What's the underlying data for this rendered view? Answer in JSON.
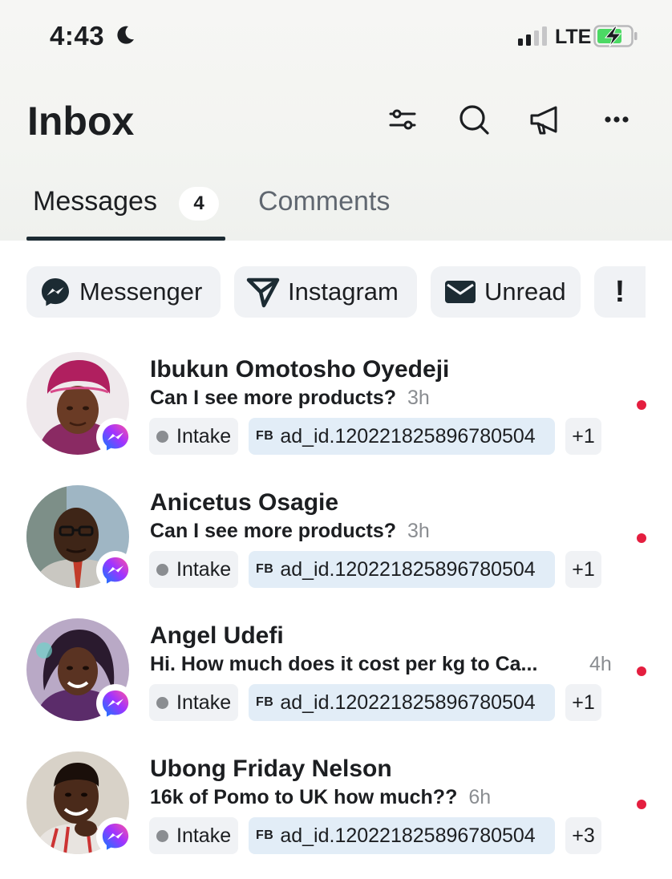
{
  "status_bar": {
    "time": "4:43",
    "network": "LTE",
    "moon_icon": "moon-icon",
    "signal_icon": "signal-bars-icon",
    "battery_icon": "battery-charging-icon"
  },
  "header": {
    "title": "Inbox",
    "icons": [
      "filter-sliders-icon",
      "search-icon",
      "megaphone-icon",
      "more-dots-icon"
    ]
  },
  "tabs": [
    {
      "label": "Messages",
      "badge": "4",
      "active": true
    },
    {
      "label": "Comments",
      "active": false
    }
  ],
  "filters": [
    {
      "label": "Messenger",
      "icon": "messenger-icon"
    },
    {
      "label": "Instagram",
      "icon": "instagram-direct-icon"
    },
    {
      "label": "Unread",
      "icon": "envelope-icon"
    },
    {
      "label": "!",
      "icon": ""
    }
  ],
  "conversations": [
    {
      "name": "Ibukun Omotosho Oyedeji",
      "preview": "Can I see more products?",
      "time": "3h",
      "unread": true,
      "tags": {
        "status": "Intake",
        "ad_prefix": "FB",
        "ad": "ad_id.120221825896780504",
        "more": "+1"
      }
    },
    {
      "name": "Anicetus Osagie",
      "preview": "Can I see more products?",
      "time": "3h",
      "unread": true,
      "tags": {
        "status": "Intake",
        "ad_prefix": "FB",
        "ad": "ad_id.120221825896780504",
        "more": "+1"
      }
    },
    {
      "name": "Angel Udefi",
      "preview": "Hi. How much does it cost per kg to Ca...",
      "time": "4h",
      "unread": true,
      "tags": {
        "status": "Intake",
        "ad_prefix": "FB",
        "ad": "ad_id.120221825896780504",
        "more": "+1"
      }
    },
    {
      "name": "Ubong Friday Nelson",
      "preview": "16k of Pomo to UK how much??",
      "time": "6h",
      "unread": true,
      "tags": {
        "status": "Intake",
        "ad_prefix": "FB",
        "ad": "ad_id.120221825896780504",
        "more": "+3"
      }
    }
  ],
  "colors": {
    "unread_dot": "#e41e3f",
    "ad_tag_bg": "#e2edf7",
    "chip_bg": "#f0f2f5",
    "messenger_gradient_start": "#0a7cff",
    "messenger_gradient_end": "#ff52a2"
  }
}
